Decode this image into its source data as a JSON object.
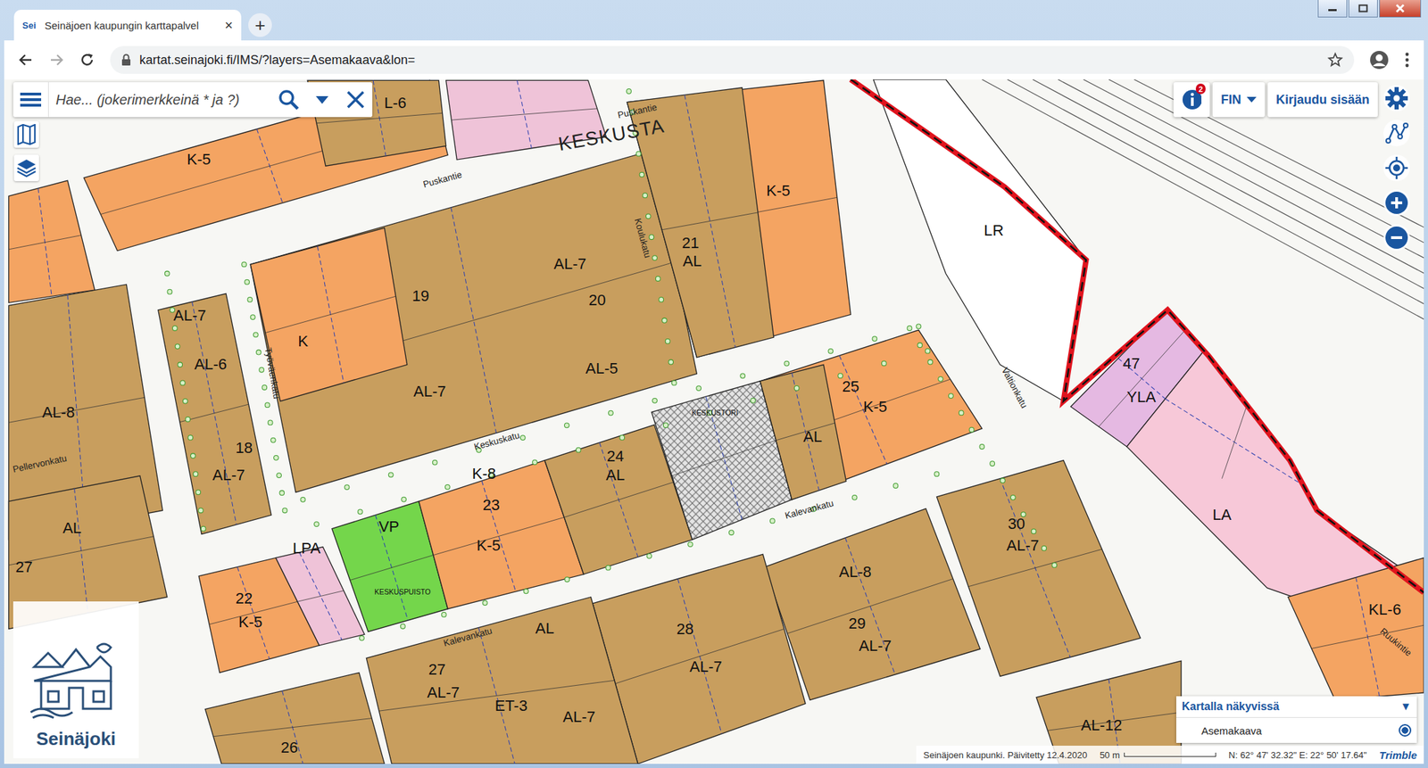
{
  "window": {
    "tab_favicon": "Sei",
    "tab_title": "Seinäjoen kaupungin karttapalvel",
    "tab_close": "×",
    "new_tab": "+"
  },
  "address_bar": {
    "url": "kartat.seinajoki.fi/IMS/?layers=Asemakaava&lon="
  },
  "search": {
    "placeholder": "Hae... (jokerimerkkeinä * ja ?)"
  },
  "top_right": {
    "info_badge": "2",
    "language": "FIN",
    "login": "Kirjaudu sisään"
  },
  "map": {
    "area_label": "KESKUSTA",
    "blocks": [
      {
        "kind": "fill",
        "color": "#c89e5e",
        "labels": [
          "AL-8"
        ]
      },
      {
        "kind": "fill",
        "color": "#f4a462",
        "labels": []
      },
      {
        "kind": "fill",
        "color": "#f4a462",
        "labels": [
          "K-5"
        ]
      },
      {
        "kind": "fill",
        "color": "#c89e5e",
        "labels": [
          "L-6"
        ]
      },
      {
        "kind": "fill",
        "color": "#efc3d8",
        "labels": []
      },
      {
        "kind": "fill",
        "color": "#c89e5e",
        "labels": [
          "19",
          "AL-7",
          "AL-7",
          "20",
          "AL-5"
        ]
      },
      {
        "kind": "fill",
        "color": "#f4a462",
        "labels": [
          "K"
        ]
      },
      {
        "kind": "fill",
        "color": "#f4a462",
        "labels": [
          "K-5"
        ]
      },
      {
        "kind": "fill",
        "color": "#c89e5e",
        "labels": [
          "21",
          "AL"
        ]
      },
      {
        "kind": "fill",
        "color": "#c89e5e",
        "labels": [
          "AL-7",
          "AL-6",
          "18",
          "AL-7"
        ]
      },
      {
        "kind": "fill",
        "color": "#c89e5e",
        "labels": [
          "AL",
          "27"
        ]
      },
      {
        "kind": "fill",
        "color": "#f4a462",
        "labels": [
          "22",
          "K-5"
        ]
      },
      {
        "kind": "fill",
        "color": "#efc3d8",
        "labels": [
          "LPA"
        ]
      },
      {
        "kind": "fill",
        "color": "#74d64b",
        "labels": [
          "VP",
          "KESKUSPUISTO"
        ]
      },
      {
        "kind": "fill",
        "color": "#f4a462",
        "labels": [
          "K-8",
          "23",
          "K-5"
        ]
      },
      {
        "kind": "fill",
        "color": "#c89e5e",
        "labels": [
          "24",
          "AL"
        ]
      },
      {
        "kind": "hatch",
        "color": "#bdbdbd",
        "labels": [
          "KESKUSTORI"
        ]
      },
      {
        "kind": "fill",
        "color": "#f4a462",
        "labels": [
          "25",
          "K-5"
        ]
      },
      {
        "kind": "fill",
        "color": "#c89e5e",
        "labels": [
          "AL"
        ]
      },
      {
        "kind": "fill",
        "color": "#c89e5e",
        "labels": [
          "30",
          "AL-7"
        ]
      },
      {
        "kind": "fill",
        "color": "#c89e5e",
        "labels": [
          "AL-8",
          "29",
          "AL-7"
        ]
      },
      {
        "kind": "fill",
        "color": "#c89e5e",
        "labels": [
          "28",
          "AL-7"
        ]
      },
      {
        "kind": "fill",
        "color": "#c89e5e",
        "labels": [
          "AL",
          "27",
          "AL-7",
          "ET-3",
          "AL-7"
        ]
      },
      {
        "kind": "fill",
        "color": "#c89e5e",
        "labels": [
          "26"
        ]
      },
      {
        "kind": "fill",
        "color": "#e5b9e2",
        "labels": [
          "47",
          "YLA"
        ]
      },
      {
        "kind": "fill",
        "color": "#f7c8d8",
        "labels": [
          "LA"
        ]
      },
      {
        "kind": "fill",
        "color": "#f4a462",
        "labels": [
          "KL-6"
        ]
      },
      {
        "kind": "fill",
        "color": "#c89e5e",
        "labels": [
          "AL-12"
        ]
      },
      {
        "kind": "fill",
        "color": "#ffffff",
        "labels": [
          "LR"
        ]
      }
    ],
    "streets": [
      "Puskantie",
      "Puskantie",
      "Keskuskatu",
      "Kalevankatu",
      "Kalevankatu",
      "Valtionkatu",
      "Työväenkatu",
      "Pellervonkatu",
      "Ruukintie",
      "Koulukatu"
    ]
  },
  "logo": {
    "text": "Seinäjoki"
  },
  "footer": {
    "attribution": "Seinäjoen kaupunki. Päivitetty 12.4.2020",
    "scale": "50 m",
    "coordinates": "N: 62° 47' 32.32\" E: 22° 50' 17.64\"",
    "brand": "Trimble"
  },
  "layers_panel": {
    "title": "Kartalla näkyvissä",
    "caret": "▼",
    "items": [
      {
        "label": "Asemakaava",
        "visible": true
      }
    ]
  }
}
